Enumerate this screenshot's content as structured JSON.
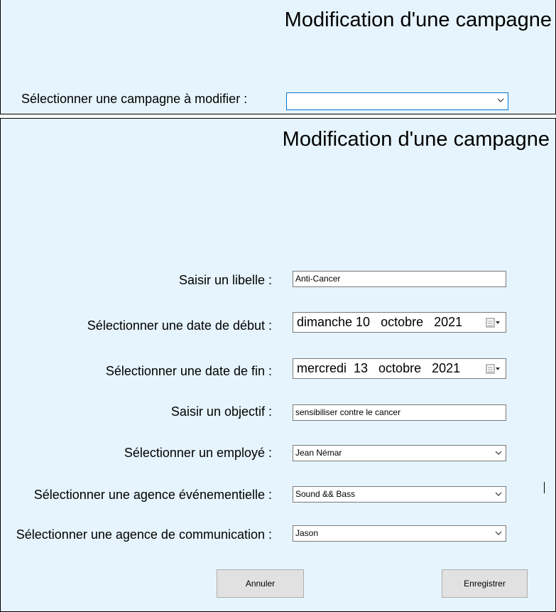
{
  "top": {
    "title": "Modification d'une campagne",
    "select_label": "Sélectionner une campagne à modifier :",
    "select_value": ""
  },
  "form": {
    "title": "Modification d'une campagne",
    "libelle_label": "Saisir un libelle :",
    "libelle_value": "Anti-Cancer",
    "start_label": "Sélectionner une date de début :",
    "start_value": "dimanche 10   octobre   2021",
    "end_label": "Sélectionner une date de fin :",
    "end_value": "mercredi  13   octobre   2021",
    "objectif_label": "Saisir un objectif :",
    "objectif_value": "sensibiliser contre le cancer",
    "employee_label": "Sélectionner un employé :",
    "employee_value": "Jean Némar",
    "event_agency_label": "Sélectionner une agence événementielle :",
    "event_agency_value": "Sound && Bass",
    "comm_agency_label": "Sélectionner une agence de communication :",
    "comm_agency_value": "Jason",
    "cancel_label": "Annuler",
    "save_label": "Enregistrer"
  },
  "icons": {
    "dropdown": "chevron-down-icon",
    "calendar": "calendar-icon"
  },
  "colors": {
    "panel_bg": "#e6f4fd",
    "focus_border": "#0078d7",
    "button_bg": "#e1e1e1"
  }
}
